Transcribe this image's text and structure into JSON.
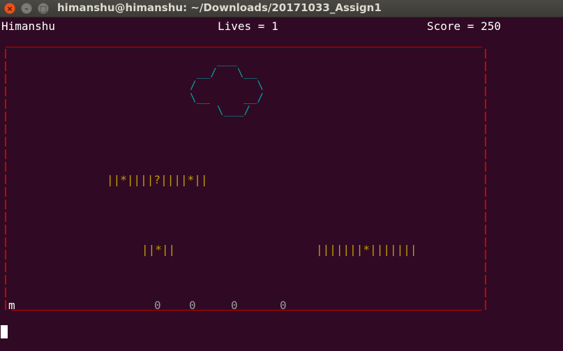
{
  "window": {
    "title": "himanshu@himanshu: ~/Downloads/20171033_Assign1",
    "close_glyph": "×",
    "minimize_glyph": "–",
    "maximize_glyph": "□"
  },
  "hud": {
    "player": "Himanshu",
    "lives": "Lives = 1",
    "score": "Score = 250"
  },
  "boss": {
    "art": [
      "   ___",
      "__/   \\__",
      "/         \\",
      "\\__     __/",
      "   \\___/"
    ]
  },
  "platforms": [
    "||*||||?||||*||",
    "||*||",
    "|||||||*|||||||"
  ],
  "ground": {
    "player_glyph": "m",
    "coins": [
      "0",
      "0",
      "0",
      "0"
    ]
  },
  "colors": {
    "background": "#300a24",
    "border": "#cc0000",
    "boss": "#06989a",
    "platform": "#c4a000",
    "coin": "#9a9a9a",
    "text": "#ffffff"
  }
}
